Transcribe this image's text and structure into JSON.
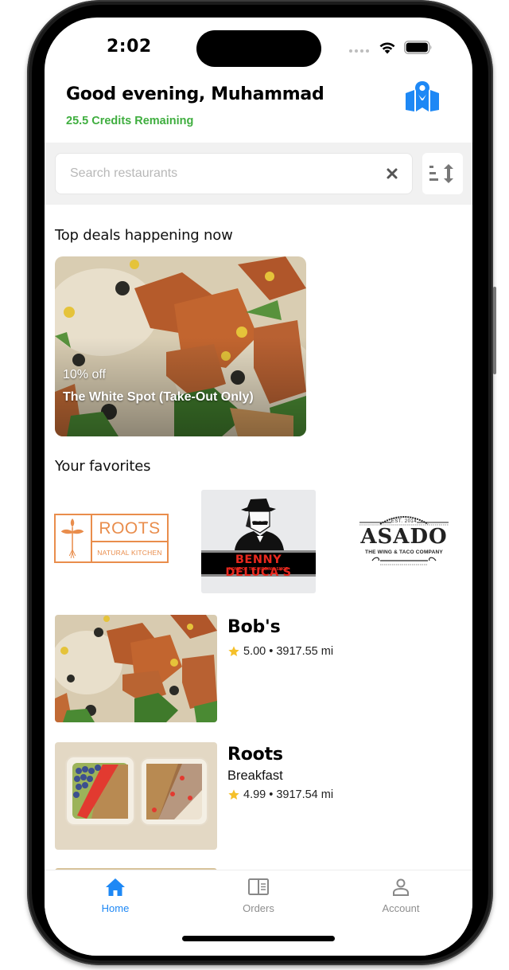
{
  "status_bar": {
    "time": "2:02"
  },
  "header": {
    "greeting": "Good evening, Muhammad",
    "credits": "25.5 Credits Remaining",
    "map_icon": "map-pin-icon"
  },
  "search": {
    "placeholder": "Search restaurants",
    "value": "",
    "clear_icon": "close-icon",
    "sort_icon": "sort-icon"
  },
  "deals": {
    "title": "Top deals happening now",
    "items": [
      {
        "discount": "10% off",
        "restaurant": "The White Spot (Take-Out Only)"
      }
    ]
  },
  "favorites": {
    "title": "Your favorites",
    "items": [
      {
        "name": "ROOTS",
        "tagline": "NATURAL KITCHEN"
      },
      {
        "name": "BENNY DELUCA'S",
        "tagline": "HOME OF THE VIRGINIA SLICE"
      },
      {
        "name": "ASADO",
        "est": "EST. 2014",
        "tagline": "THE WING & TACO COMPANY"
      }
    ]
  },
  "restaurants": [
    {
      "name": "Bob's",
      "category": "",
      "rating": "5.00",
      "distance": "3917.55 mi"
    },
    {
      "name": "Roots",
      "category": "Breakfast",
      "rating": "4.99",
      "distance": "3917.54 mi"
    }
  ],
  "tabs": [
    {
      "label": "Home",
      "icon": "home-icon",
      "active": true
    },
    {
      "label": "Orders",
      "icon": "orders-icon",
      "active": false
    },
    {
      "label": "Account",
      "icon": "account-icon",
      "active": false
    }
  ],
  "colors": {
    "accent": "#1E88F5",
    "credits_green": "#3FAE3F",
    "star": "#F5C02A",
    "roots_orange": "#E98D4C",
    "benny_red": "#E8281E"
  }
}
